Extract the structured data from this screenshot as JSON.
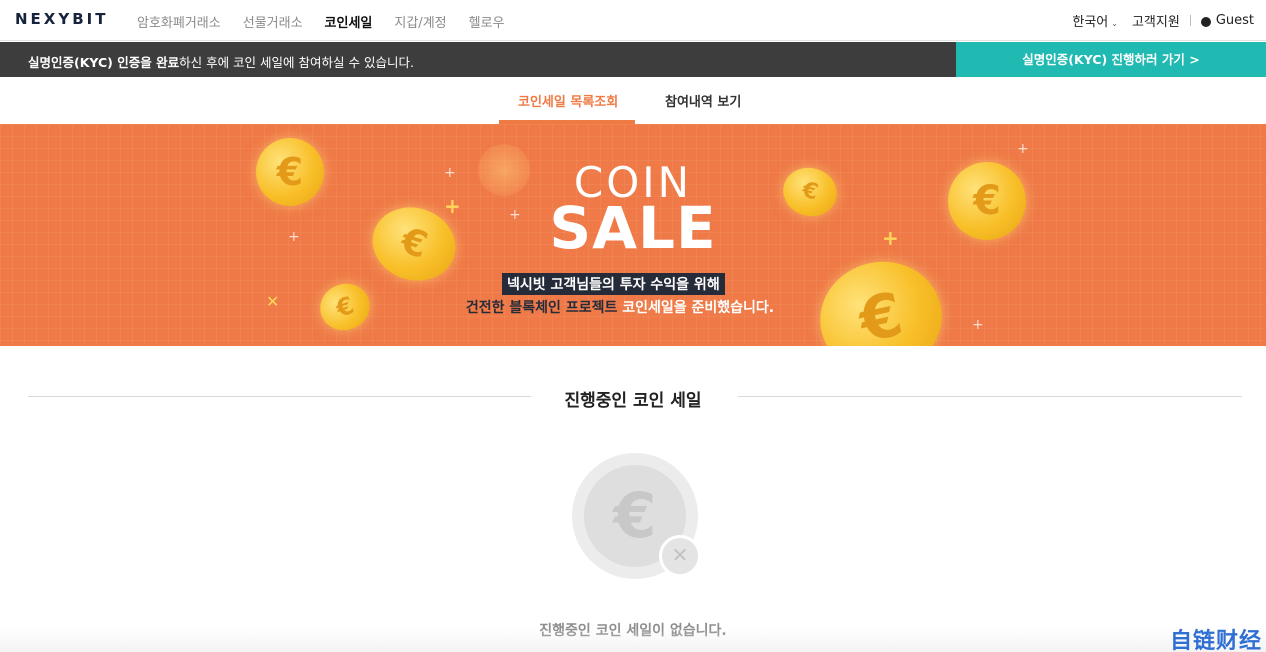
{
  "header": {
    "logo": "NEXYBIT",
    "nav": [
      "암호화폐거래소",
      "선물거래소",
      "코인세일",
      "지갑/계정",
      "헬로우"
    ],
    "active_nav": "코인세일",
    "language": "한국어",
    "support": "고객지원",
    "user": "Guest"
  },
  "kyc_bar": {
    "message_bold": "실명인증(KYC) 인증을 완료",
    "message_rest": "하신 후에 코인 세일에 참여하실 수 있습니다.",
    "button": "실명인증(KYC) 진행하러 가기 >",
    "accent_color": "#21bab2"
  },
  "tabs": {
    "list_tab": "코인세일 목록조회",
    "history_tab": "참여내역 보기",
    "accent_color": "#ef7a44"
  },
  "banner": {
    "coin_text": "COIN",
    "sale_text": "SALE",
    "line1": "넥시빗 고객님들의 투자 수익을 위해",
    "line2_part1": "건전한 블록체인 프로젝트 ",
    "line2_part2": "코인세일을 준비했습니다.",
    "background_color": "#ef7a47"
  },
  "section": {
    "title": "진행중인 코인 세일",
    "empty_message": "진행중인 코인 세일이 없습니다."
  },
  "watermark": "自链财经"
}
